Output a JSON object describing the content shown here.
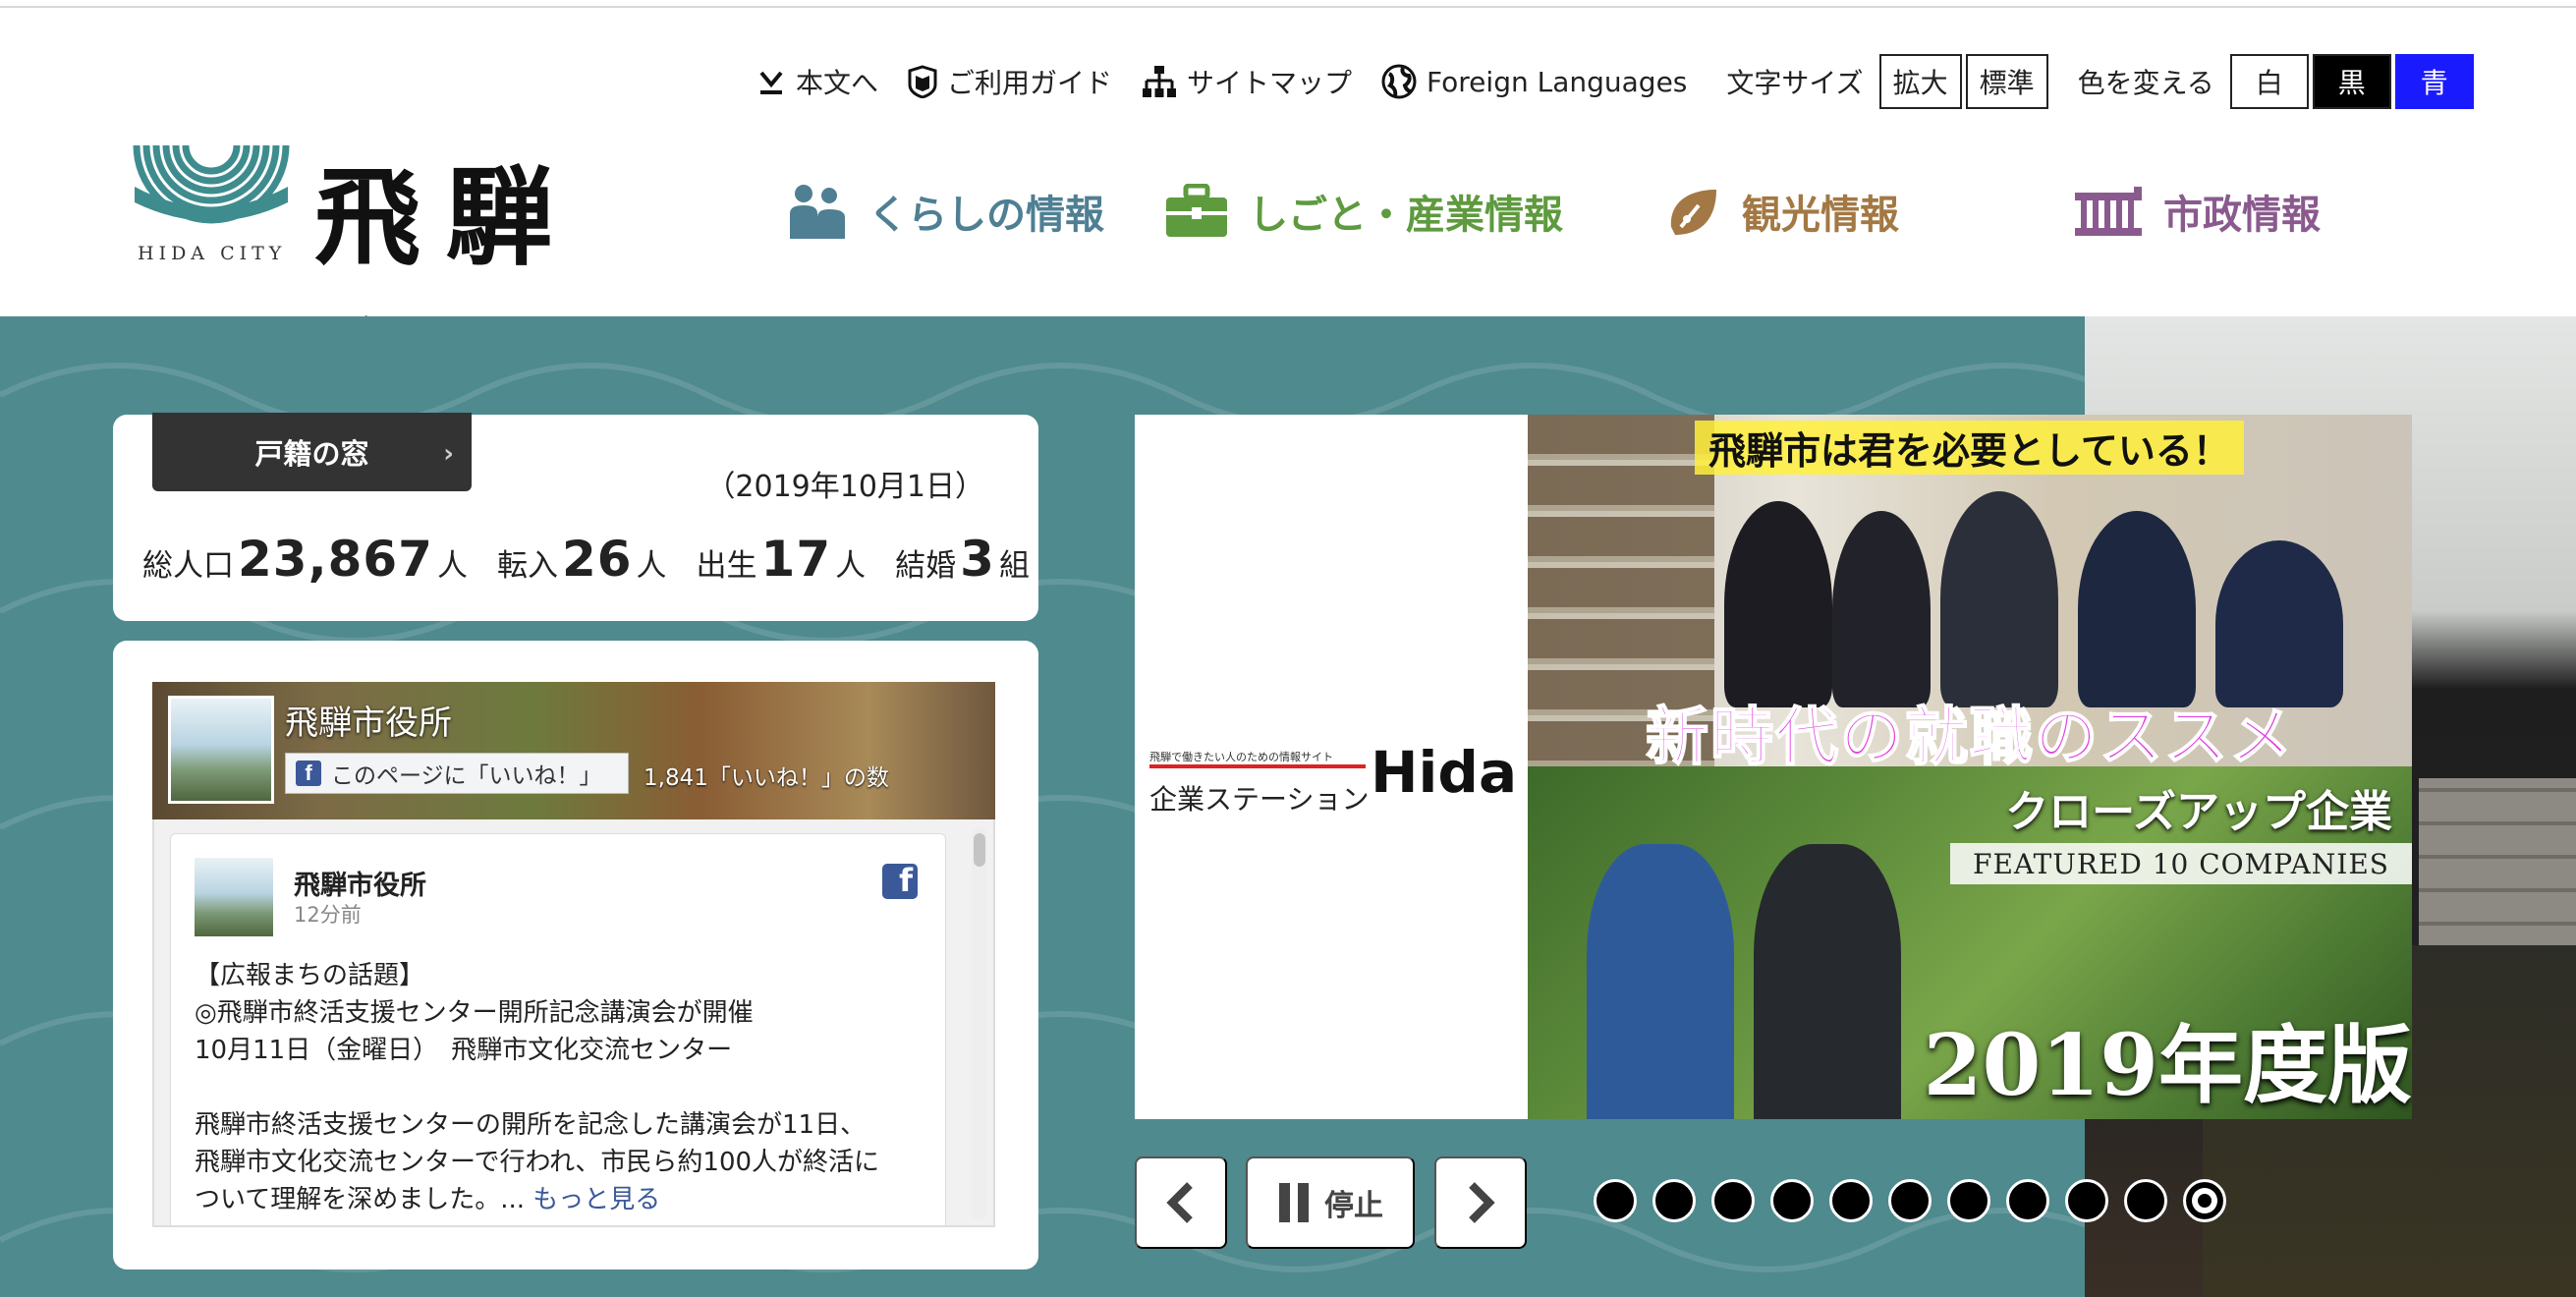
{
  "utility": {
    "skip_link": "本文へ",
    "guide": "ご利用ガイド",
    "sitemap": "サイトマップ",
    "foreign": "Foreign Languages",
    "text_size_label": "文字サイズ",
    "text_size_enlarge": "拡大",
    "text_size_standard": "標準",
    "color_label": "色を変える",
    "color_white": "白",
    "color_black": "黒",
    "color_blue": "青"
  },
  "logo": {
    "name": "飛騨市",
    "subtitle": "HIDA CITY"
  },
  "nav": [
    {
      "label": "くらしの情報",
      "icon": "family-icon",
      "color": "#4f7f93"
    },
    {
      "label": "しごと・産業情報",
      "icon": "briefcase-icon",
      "color": "#5e9a3e"
    },
    {
      "label": "観光情報",
      "icon": "leaf-icon",
      "color": "#a37844"
    },
    {
      "label": "市政情報",
      "icon": "city-hall-icon",
      "color": "#8a5a8e"
    }
  ],
  "census": {
    "tab": "戸籍の窓",
    "date": "（2019年10月1日）",
    "population_label": "総人口",
    "population": "23,867",
    "population_unit": "人",
    "movein_label": "転入",
    "movein": "26",
    "movein_unit": "人",
    "births_label": "出生",
    "births": "17",
    "births_unit": "人",
    "marriages_label": "結婚",
    "marriages": "3",
    "marriages_unit": "組"
  },
  "facebook": {
    "page_name": "飛騨市役所",
    "like_button": "このページに「いいね！」",
    "like_count": "1,841「いいね！」の数",
    "post": {
      "author": "飛騨市役所",
      "time": "12分前",
      "text": "【広報まちの話題】\n◎飛騨市終活支援センター開所記念講演会が開催\n10月11日（金曜日）　飛騨市文化交流センター\n\n飛騨市終活支援センターの開所を記念した講演会が11日、\n飛騨市文化交流センターで行われ、市民ら約100人が終活に\nついて理解を深めました。... ",
      "more": "もっと見る"
    }
  },
  "slider": {
    "station_small": "飛騨で働きたい人のための情報サイト",
    "station_name": "企業ステーション",
    "station_hida": "Hida",
    "top_title": "飛騨市は君を必要としている！",
    "top_caption": "新時代の就職のススメ",
    "closeup": "クローズアップ企業",
    "featured": "FEATURED 10 COMPANIES",
    "edition": "2019年度版",
    "stop_label": "停止",
    "dot_count": 11,
    "active_dot": 11
  }
}
